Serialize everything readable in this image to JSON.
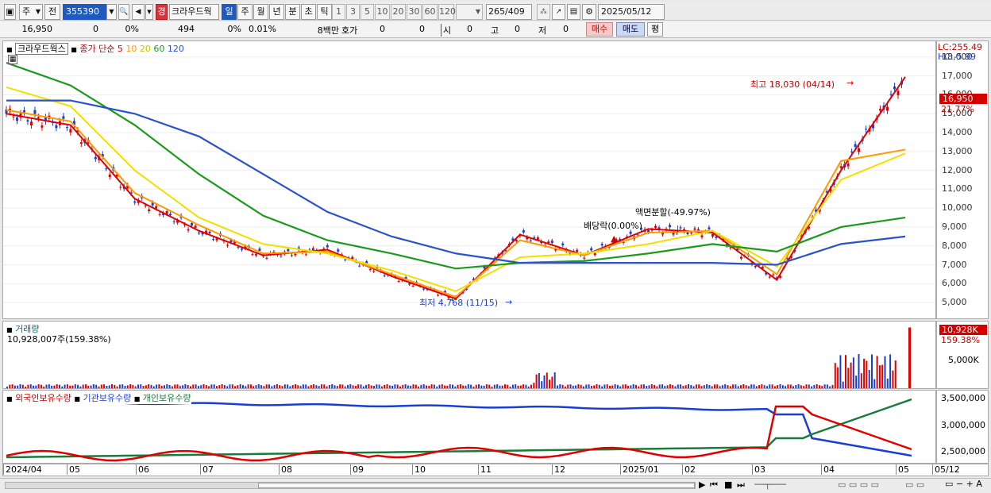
{
  "toolbar": {
    "type_select": "주",
    "prev_label": "전",
    "code": "355390",
    "market_badge": "경",
    "stock_name": "크라우드웍",
    "periods": [
      "일",
      "주",
      "월",
      "년",
      "분",
      "초",
      "틱"
    ],
    "active_period": "일",
    "intervals": [
      "1",
      "3",
      "5",
      "10",
      "20",
      "30",
      "60",
      "120"
    ],
    "count": "265",
    "total": "/409",
    "date": "2025/05/12"
  },
  "infobar": {
    "price": "16,950",
    "change": "0",
    "change_pct": "0%",
    "vol1": "494",
    "pct2": "0%",
    "pct3": "0.01%",
    "amount": "8백만",
    "hoga": "호가",
    "h1": "0",
    "h2": "0",
    "si": "시",
    "si_v": "0",
    "go": "고",
    "go_v": "0",
    "jeo": "저",
    "jeo_v": "0",
    "buy": "매수",
    "sell": "매도",
    "pyeong": "평"
  },
  "price_panel": {
    "legend_name": "크라우드웍스",
    "legend_type": "종가 단순",
    "ma": [
      {
        "label": "5",
        "color": "#e00000"
      },
      {
        "label": "10",
        "color": "#ff9900"
      },
      {
        "label": "20",
        "color": "#e8d800"
      },
      {
        "label": "60",
        "color": "#1a9a1a"
      },
      {
        "label": "120",
        "color": "#2a52c9"
      }
    ],
    "lc": "LC:255.49",
    "hc": "HC:-5.99",
    "current": "16,950",
    "current_pct": "21.77%",
    "ann_high": "최고 18,030 (04/14)",
    "ann_low": "최저 4,768 (11/15)",
    "ann_div": "배당락(0.00%)",
    "ann_split": "액면분할(-49.97%)",
    "yticks": [
      "18,000",
      "17,000",
      "16,000",
      "15,000",
      "14,000",
      "13,000",
      "12,000",
      "11,000",
      "10,000",
      "9,000",
      "8,000",
      "7,000",
      "6,000",
      "5,000"
    ]
  },
  "volume_panel": {
    "title": "거래량",
    "value": "10,928,007주(159.38%)",
    "badge": "10,928K",
    "badge_pct": "159.38%",
    "ytick": "5,000K"
  },
  "holding_panel": {
    "legend": [
      "외국인보유수량",
      "기관보유수량",
      "개인보유수량"
    ],
    "yticks": [
      "3,500,000",
      "3,000,000",
      "2,500,000"
    ]
  },
  "xaxis": [
    "2024/04",
    "05",
    "06",
    "07",
    "08",
    "09",
    "10",
    "11",
    "12",
    "2025/01",
    "02",
    "03",
    "04",
    "05",
    "05/12"
  ],
  "colors": {
    "up": "#e00000",
    "down": "#1a3fd0",
    "accent": "#1f5bbf"
  },
  "chart_data": {
    "type": "line",
    "title": "크라우드웍스",
    "xlabel": "",
    "ylabel": "",
    "x": [
      "2024/04",
      "2024/05",
      "2024/06",
      "2024/07",
      "2024/08",
      "2024/09",
      "2024/10",
      "2024/11",
      "2024/12",
      "2025/01",
      "2025/02",
      "2025/03",
      "2025/04",
      "2025/05",
      "2025/05/12"
    ],
    "ylim": [
      4500,
      18500
    ],
    "series": [
      {
        "name": "종가",
        "values": [
          15000,
          14400,
          10500,
          8800,
          7500,
          7800,
          6400,
          5200,
          8600,
          7500,
          8900,
          8700,
          6200,
          12000,
          16950
        ]
      },
      {
        "name": "5",
        "values": [
          15000,
          14400,
          10500,
          8800,
          7500,
          7800,
          6400,
          5200,
          8600,
          7500,
          8900,
          8700,
          6200,
          12000,
          16950
        ]
      },
      {
        "name": "10",
        "values": [
          15200,
          14600,
          10800,
          9100,
          7600,
          7700,
          6500,
          5300,
          8300,
          7500,
          8700,
          8800,
          6500,
          12500,
          13100
        ]
      },
      {
        "name": "20",
        "values": [
          16400,
          15400,
          12000,
          9500,
          8100,
          7600,
          6700,
          5600,
          7400,
          7600,
          8100,
          8800,
          6900,
          11500,
          12900
        ]
      },
      {
        "name": "60",
        "values": [
          17700,
          16500,
          14400,
          11800,
          9600,
          8300,
          7600,
          6800,
          7100,
          7200,
          7600,
          8100,
          7700,
          9000,
          9500
        ]
      },
      {
        "name": "120",
        "values": [
          15700,
          15700,
          15000,
          13800,
          11800,
          9800,
          8500,
          7600,
          7100,
          7100,
          7100,
          7100,
          7000,
          8100,
          8500
        ]
      }
    ],
    "high": {
      "value": 18030,
      "date": "04/14"
    },
    "low": {
      "value": 4768,
      "date": "11/15"
    },
    "volume_last": 10928007
  }
}
